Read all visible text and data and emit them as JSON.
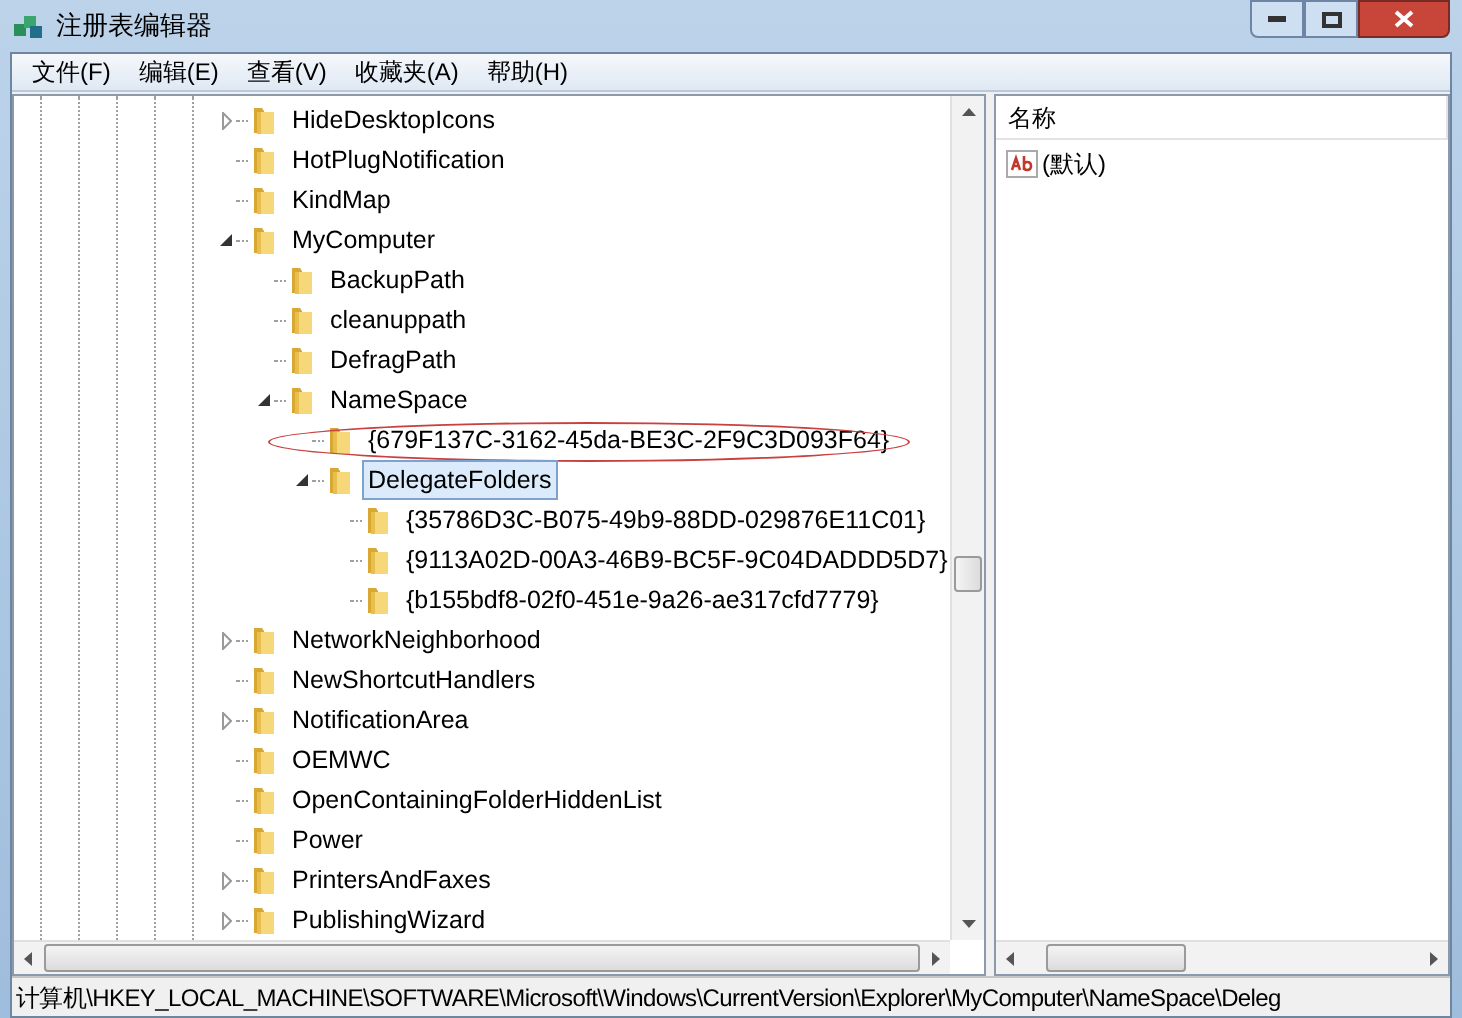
{
  "window": {
    "title": "注册表编辑器"
  },
  "menu": [
    "文件(F)",
    "编辑(E)",
    "查看(V)",
    "收藏夹(A)",
    "帮助(H)"
  ],
  "tree": [
    {
      "label": "HideDesktopIcons",
      "expandable": true,
      "expanded": false,
      "selected": false
    },
    {
      "label": "HotPlugNotification",
      "expandable": false,
      "selected": false
    },
    {
      "label": "KindMap",
      "expandable": false,
      "selected": false
    },
    {
      "label": "MyComputer",
      "expandable": true,
      "expanded": true,
      "selected": false,
      "children": [
        {
          "label": "BackupPath",
          "expandable": false,
          "selected": false
        },
        {
          "label": "cleanuppath",
          "expandable": false,
          "selected": false
        },
        {
          "label": "DefragPath",
          "expandable": false,
          "selected": false
        },
        {
          "label": "NameSpace",
          "expandable": true,
          "expanded": true,
          "selected": false,
          "children": [
            {
              "label": "{679F137C-3162-45da-BE3C-2F9C3D093F64}",
              "expandable": false,
              "selected": false,
              "circled": true
            },
            {
              "label": "DelegateFolders",
              "expandable": true,
              "expanded": true,
              "selected": true,
              "children": [
                {
                  "label": "{35786D3C-B075-49b9-88DD-029876E11C01}",
                  "expandable": false,
                  "selected": false
                },
                {
                  "label": "{9113A02D-00A3-46B9-BC5F-9C04DADDD5D7}",
                  "expandable": false,
                  "selected": false
                },
                {
                  "label": "{b155bdf8-02f0-451e-9a26-ae317cfd7779}",
                  "expandable": false,
                  "selected": false
                }
              ]
            }
          ]
        }
      ]
    },
    {
      "label": "NetworkNeighborhood",
      "expandable": true,
      "expanded": false,
      "selected": false
    },
    {
      "label": "NewShortcutHandlers",
      "expandable": false,
      "selected": false
    },
    {
      "label": "NotificationArea",
      "expandable": true,
      "expanded": false,
      "selected": false
    },
    {
      "label": "OEMWC",
      "expandable": false,
      "selected": false
    },
    {
      "label": "OpenContainingFolderHiddenList",
      "expandable": false,
      "selected": false
    },
    {
      "label": "Power",
      "expandable": false,
      "selected": false
    },
    {
      "label": "PrintersAndFaxes",
      "expandable": true,
      "expanded": false,
      "selected": false
    },
    {
      "label": "PublishingWizard",
      "expandable": true,
      "expanded": false,
      "selected": false
    }
  ],
  "values": {
    "columns": [
      "名称"
    ],
    "rows": [
      {
        "name": "(默认)"
      }
    ]
  },
  "status_bar": "计算机\\HKEY_LOCAL_MACHINE\\SOFTWARE\\Microsoft\\Windows\\CurrentVersion\\Explorer\\MyComputer\\NameSpace\\Deleg"
}
